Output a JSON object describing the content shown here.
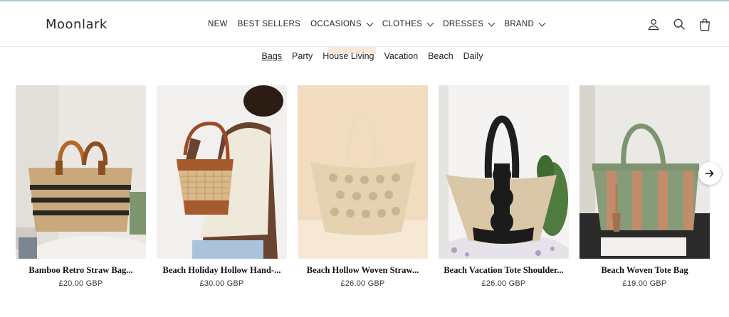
{
  "brand": {
    "logo_text": "Moonlark"
  },
  "header": {
    "nav": [
      {
        "label": "NEW",
        "has_dropdown": false
      },
      {
        "label": "BEST SELLERS",
        "has_dropdown": false
      },
      {
        "label": "OCCASIONS",
        "has_dropdown": true
      },
      {
        "label": "CLOTHES",
        "has_dropdown": true
      },
      {
        "label": "DRESSES",
        "has_dropdown": true
      },
      {
        "label": "BRAND",
        "has_dropdown": true
      }
    ],
    "icons": [
      "account-icon",
      "search-icon",
      "cart-icon"
    ]
  },
  "subnav": [
    {
      "label": "Bags",
      "active": true
    },
    {
      "label": "Party",
      "active": false
    },
    {
      "label": "House Living",
      "active": false
    },
    {
      "label": "Vacation",
      "active": false
    },
    {
      "label": "Beach",
      "active": false
    },
    {
      "label": "Daily",
      "active": false
    }
  ],
  "products": [
    {
      "title": "Bamboo Retro Straw Bag...",
      "price": "£20.00 GBP"
    },
    {
      "title": "Beach Holiday Hollow Hand-...",
      "price": "£30.00 GBP"
    },
    {
      "title": "Beach Hollow Woven Straw...",
      "price": "£26.00 GBP"
    },
    {
      "title": "Beach Vacation Tote Shoulder...",
      "price": "£26.00 GBP"
    },
    {
      "title": "Beach Woven Tote Bag",
      "price": "£19.00 GBP"
    }
  ],
  "carousel": {
    "next_icon": "arrow-right-icon"
  }
}
